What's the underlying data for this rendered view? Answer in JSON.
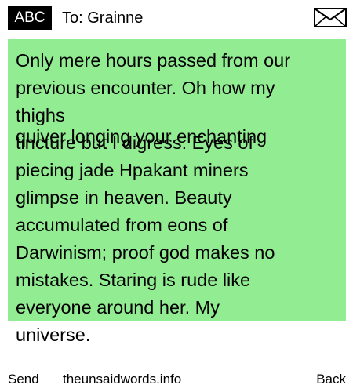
{
  "header": {
    "mode_badge": "ABC",
    "recipient": "To: Grainne",
    "envelope_icon": "envelope-icon"
  },
  "message": {
    "background_color": "#92ec92",
    "lines": [
      "Only mere hours passed from our",
      "previous encounter.  Oh how my",
      "thighs",
      "quiver longing your enchanting",
      "tincture but I digress.  Eyes of",
      "piecing jade Hpakant miners",
      "glimpse in heaven.  Beauty",
      "accumulated from eons of",
      "Darwinism; proof god makes no",
      "mistakes. Staring is rude like",
      "everyone around her.  My",
      "universe."
    ]
  },
  "footer": {
    "send_label": "Send",
    "site_label": "theunsaidwords.info",
    "back_label": "Back"
  }
}
